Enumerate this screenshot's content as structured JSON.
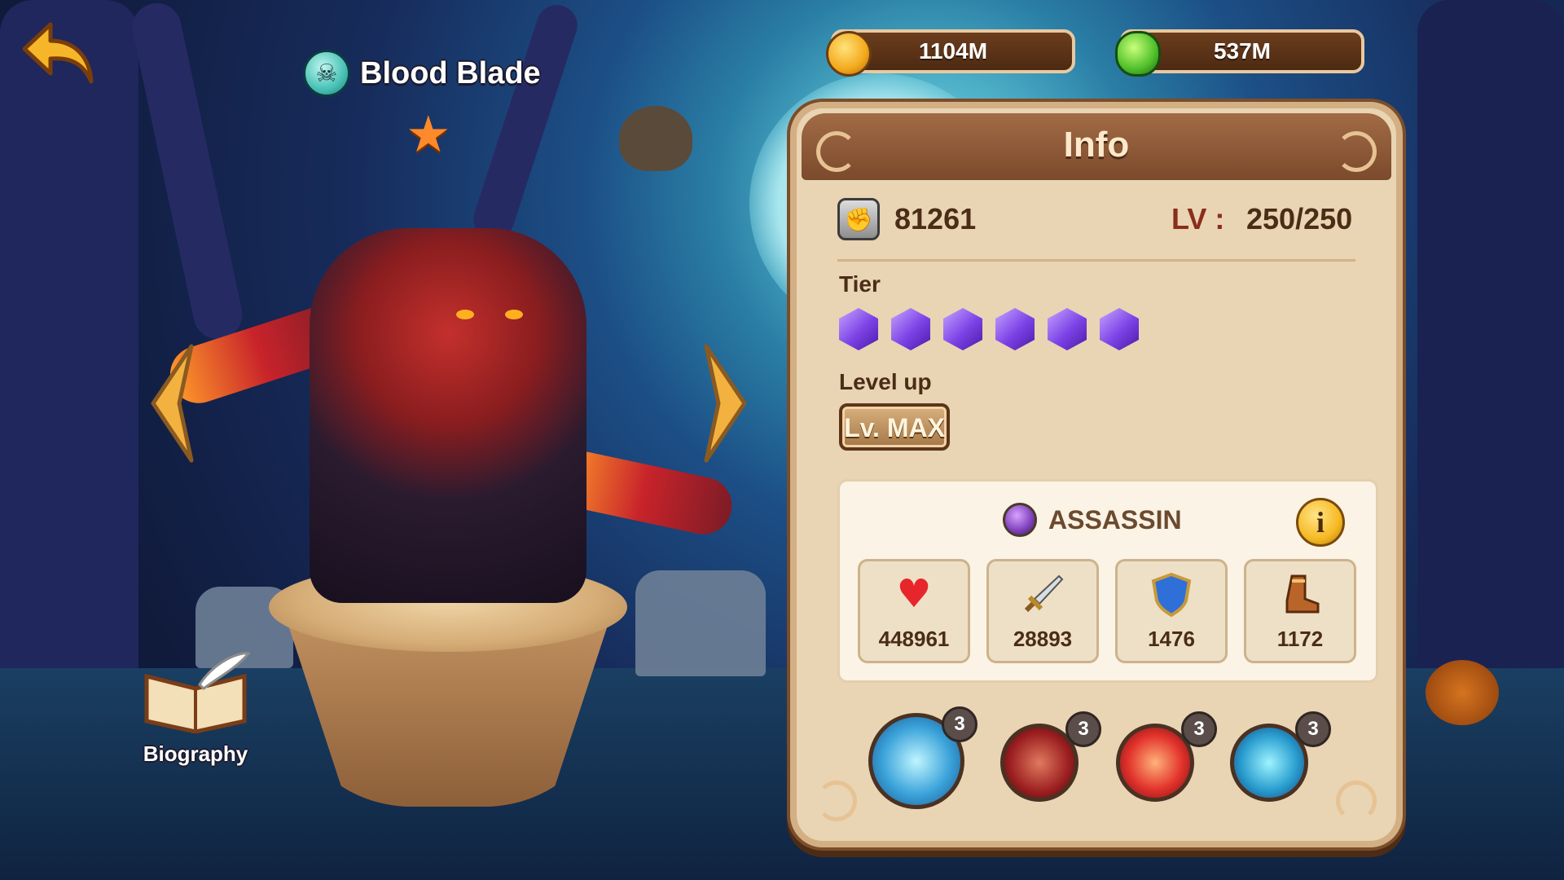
{
  "hero": {
    "name": "Blood Blade",
    "class": "ASSASSIN"
  },
  "currencies": {
    "gold": "1104M",
    "gems": "537M"
  },
  "panel": {
    "title": "Info",
    "power": "81261",
    "level_label": "LV :",
    "level_value": "250/250",
    "tier_label": "Tier",
    "tier_count": 6,
    "level_up_label": "Level up",
    "level_up_button": "Lv. MAX"
  },
  "stats": {
    "hp": "448961",
    "attack": "28893",
    "armor": "1476",
    "speed": "1172"
  },
  "skills": [
    {
      "level": "3",
      "icon": "skill-blade-icon"
    },
    {
      "level": "3",
      "icon": "skill-demon-icon"
    },
    {
      "level": "3",
      "icon": "skill-fire-icon"
    },
    {
      "level": "3",
      "icon": "skill-ghost-icon"
    }
  ],
  "biography_label": "Biography",
  "colors": {
    "panel": "#e9d4b4",
    "header": "#8c5934",
    "tier_gem": "#7c42e6"
  }
}
